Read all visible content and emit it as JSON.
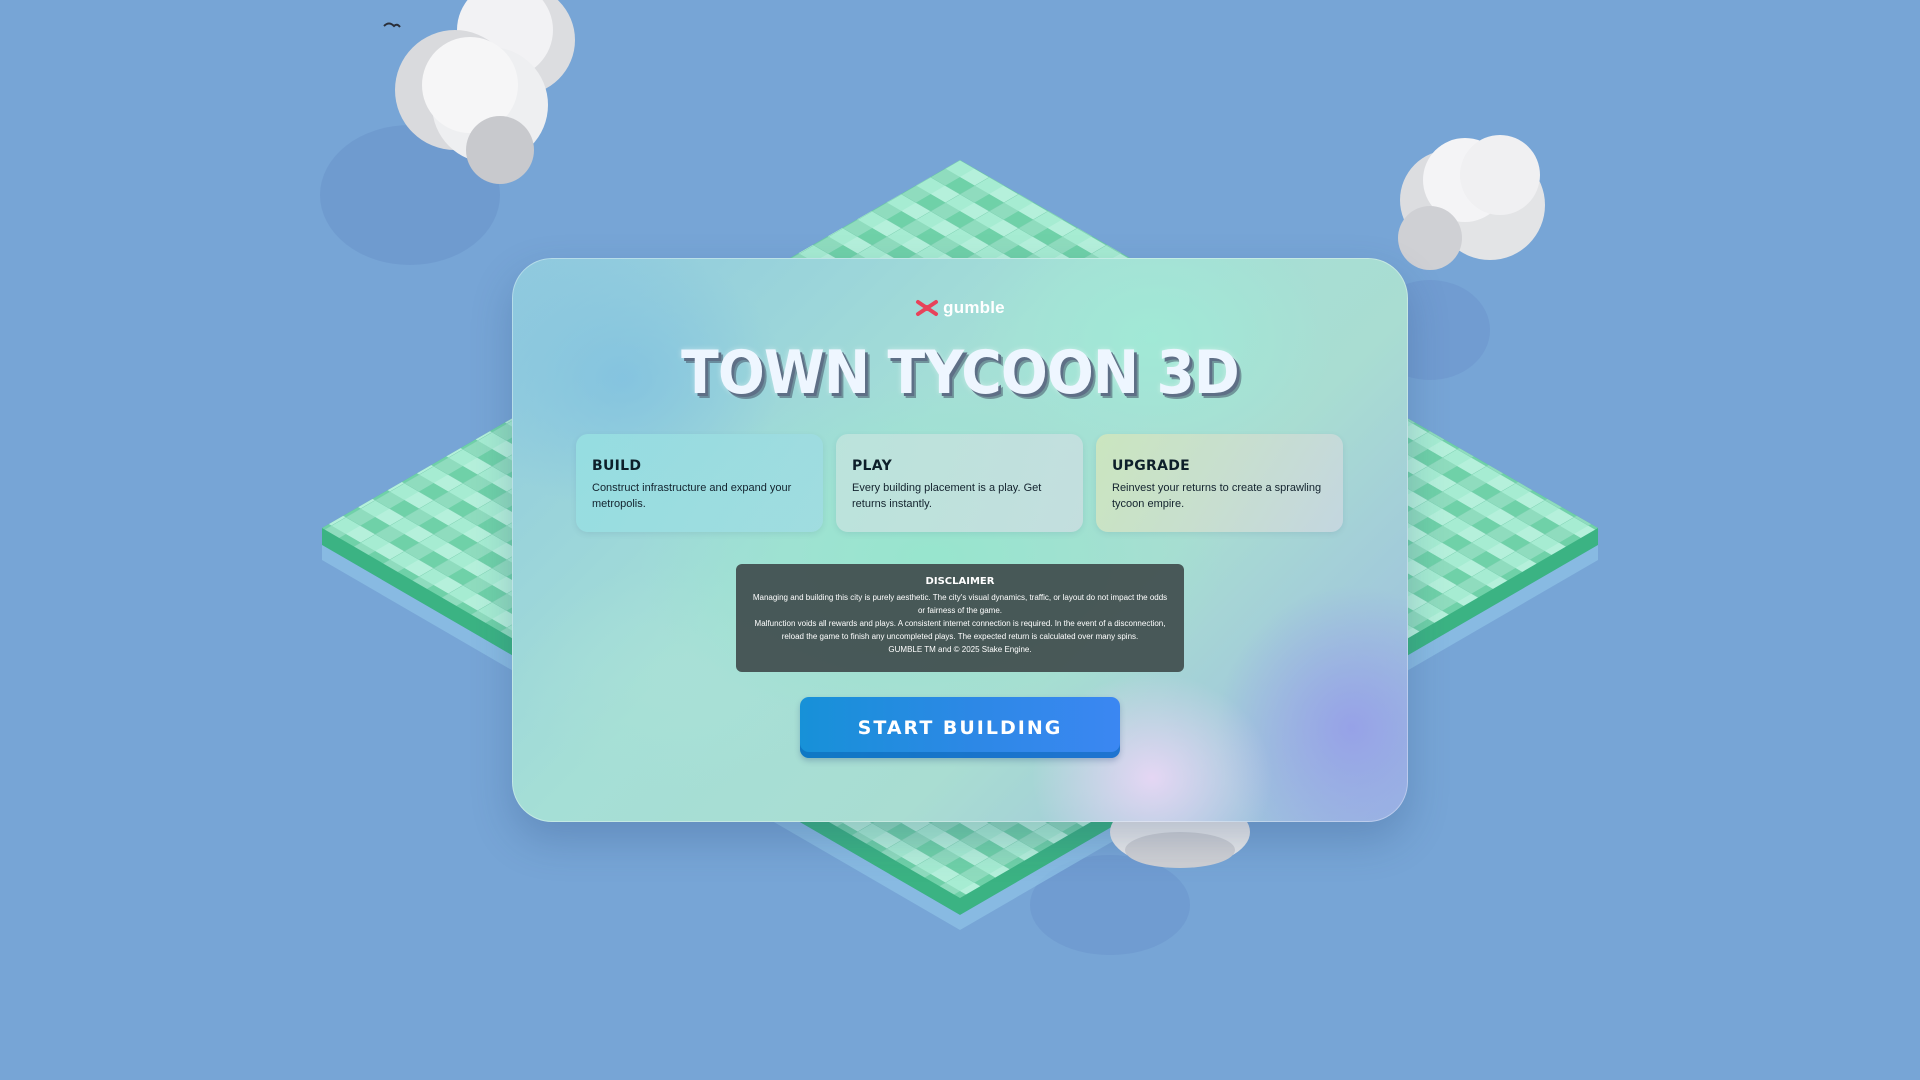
{
  "brand": {
    "name": "gumble",
    "icon": "gumble-logo-icon",
    "icon_color": "#e8425a"
  },
  "title": "TOWN TYCOON 3D",
  "cards": [
    {
      "title": "BUILD",
      "description": "Construct infrastructure and expand your metropolis."
    },
    {
      "title": "PLAY",
      "description": "Every building placement is a play. Get returns instantly."
    },
    {
      "title": "UPGRADE",
      "description": "Reinvest your returns to create a sprawling tycoon empire."
    }
  ],
  "disclaimer": {
    "title": "DISCLAIMER",
    "lines": [
      "Managing and building this city is purely aesthetic. The city's visual dynamics, traffic, or layout do not impact the odds or fairness of the game.",
      "Malfunction voids all rewards and plays. A consistent internet connection is required. In the event of a disconnection, reload the game to finish any uncompleted plays. The expected return is calculated over many spins.",
      "GUMBLE TM and © 2025 Stake Engine."
    ]
  },
  "start_button": {
    "label": "START BUILDING"
  },
  "colors": {
    "sky": "#77a5d6",
    "tile_light": "#9fe6c8",
    "tile_dark": "#5ccb9c",
    "button": "#2d88e6",
    "disclaimer_bg": "#445252"
  }
}
